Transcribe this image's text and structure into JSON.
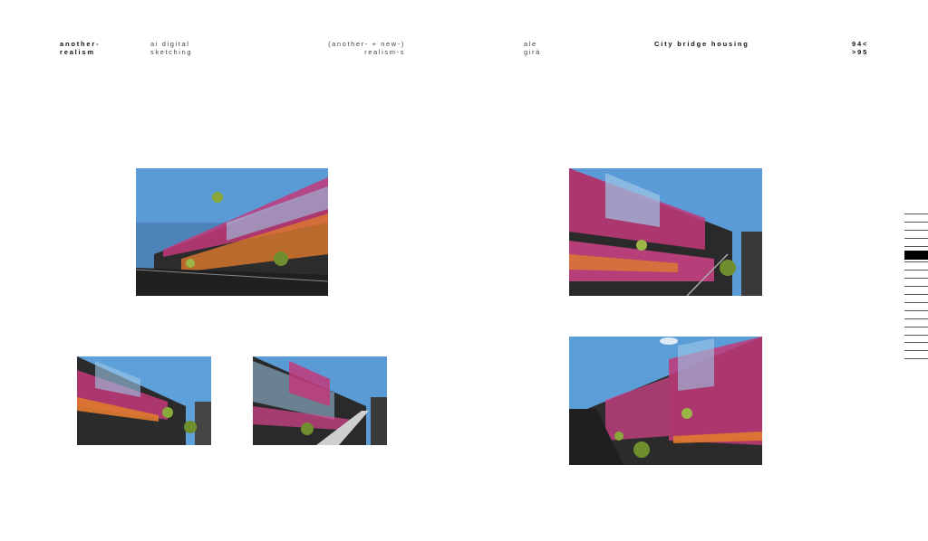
{
  "header": {
    "brand": [
      "another-",
      "realism"
    ],
    "subtitle": [
      "ai digital",
      "sketching"
    ],
    "series": [
      "(another- + new-)",
      "realism-s"
    ],
    "author": [
      "ale",
      "girá"
    ],
    "title": "City bridge housing",
    "pages": [
      "94<",
      ">95"
    ]
  },
  "images": [
    {
      "id": "img1",
      "description_icon": "photo-icon"
    },
    {
      "id": "img2",
      "description_icon": "photo-icon"
    },
    {
      "id": "img3",
      "description_icon": "photo-icon"
    },
    {
      "id": "img4",
      "description_icon": "photo-icon"
    },
    {
      "id": "img5",
      "description_icon": "photo-icon"
    }
  ],
  "page_nav": {
    "total_ticks": 19,
    "active_index": 5
  },
  "colors": {
    "sky": "#4a8fd0",
    "magenta": "#c2397a",
    "orange": "#e07a2e",
    "dark": "#2a2a2a",
    "green": "#6f8f2f"
  }
}
